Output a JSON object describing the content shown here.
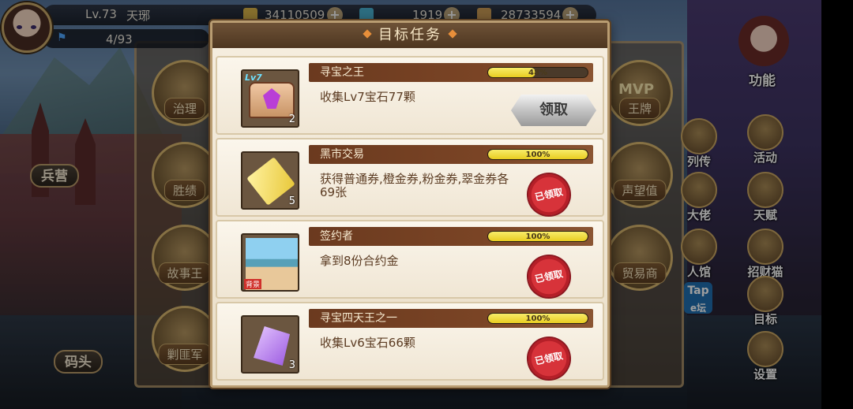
{
  "player": {
    "level_label": "Lv.73",
    "name": "天琊",
    "energy": "4/93"
  },
  "resources": [
    {
      "name": "gold",
      "value": "34110509"
    },
    {
      "name": "gem",
      "value": "1919"
    },
    {
      "name": "prestige",
      "value": "28733594"
    }
  ],
  "city": {
    "barracks_label": "兵营",
    "dock_label": "码头",
    "buttons": [
      "治理",
      "胜绩",
      "故事王",
      "剿匪军",
      "王牌",
      "声望值",
      "贸易商"
    ],
    "mvp_text": "MVP"
  },
  "side_menu": {
    "function_label": "功能",
    "items": [
      "列传",
      "活动",
      "大佬",
      "天赋",
      "人馆",
      "招财猫",
      "目标",
      "设置"
    ],
    "tap_text": "Tap",
    "tap_sub": "e坛"
  },
  "modal": {
    "title": "目标任务",
    "tasks": [
      {
        "title": "寻宝之王",
        "progress": 48,
        "progress_label": "48%",
        "desc": "收集Lv7宝石77颗",
        "count": "2",
        "lv_tag": "Lv7",
        "status": "claim",
        "claim_label": "领取"
      },
      {
        "title": "黑市交易",
        "progress": 100,
        "progress_label": "100%",
        "desc": "获得普通券,橙金券,粉金券,翠金券各69张",
        "count": "5",
        "status": "claimed",
        "claimed_label": "已领取"
      },
      {
        "title": "签约者",
        "progress": 100,
        "progress_label": "100%",
        "desc": "拿到8份合约金",
        "count": "",
        "photo_tag": "背景",
        "status": "claimed",
        "claimed_label": "已领取"
      },
      {
        "title": "寻宝四天王之一",
        "progress": 100,
        "progress_label": "100%",
        "desc": "收集Lv6宝石66颗",
        "count": "3",
        "status": "claimed",
        "claimed_label": "已领取"
      }
    ]
  },
  "colors": {
    "accent": "#e88f3a",
    "ribbon": "#6b3a1f",
    "bar_fill": "#e8cc20",
    "stamp": "#d7333a"
  }
}
